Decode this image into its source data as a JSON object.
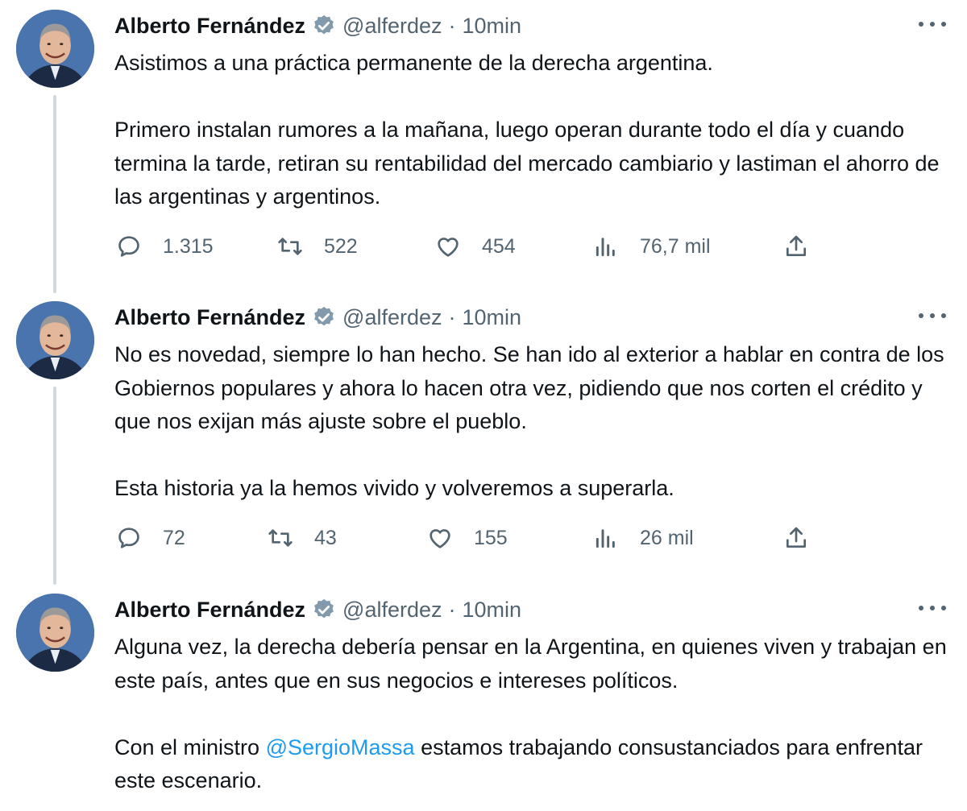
{
  "tweets": [
    {
      "author": "Alberto Fernández",
      "handle": "@alferdez",
      "separator": "·",
      "time": "10min",
      "paragraphs": [
        "Asistimos a una práctica permanente de la derecha argentina.",
        "Primero instalan rumores a la mañana, luego operan durante todo el día y cuando termina la tarde, retiran su rentabilidad del mercado cambiario y lastiman el ahorro de las argentinas y argentinos."
      ],
      "replies": "1.315",
      "retweets": "522",
      "likes": "454",
      "views": "76,7 mil"
    },
    {
      "author": "Alberto Fernández",
      "handle": "@alferdez",
      "separator": "·",
      "time": "10min",
      "paragraphs": [
        "No es novedad, siempre lo han hecho. Se han ido al exterior a hablar en contra de los Gobiernos populares y ahora lo hacen otra vez, pidiendo que nos corten el crédito y que nos exijan más ajuste sobre el pueblo.",
        "Esta historia ya la hemos vivido y volveremos a superarla."
      ],
      "replies": "72",
      "retweets": "43",
      "likes": "155",
      "views": "26 mil"
    },
    {
      "author": "Alberto Fernández",
      "handle": "@alferdez",
      "separator": "·",
      "time": "10min",
      "paragraphs": [
        "Alguna vez, la derecha debería pensar en la Argentina, en quienes viven y trabajan en este país, antes que en sus negocios e intereses políticos."
      ],
      "last_paragraph": {
        "before": "Con el ministro ",
        "mention": "@SergioMassa",
        "after": " estamos trabajando consustanciados para enfrentar este escenario."
      }
    }
  ],
  "colors": {
    "text": "#0f1419",
    "muted": "#536471",
    "link": "#1d9bf0",
    "verified_badge": "#829aab",
    "thread_line": "#cfd9de"
  },
  "icons": {
    "verified": "verified-badge-icon",
    "more": "more-options-icon",
    "reply": "reply-icon",
    "retweet": "retweet-icon",
    "like": "heart-icon",
    "views": "views-icon",
    "share": "share-icon"
  }
}
